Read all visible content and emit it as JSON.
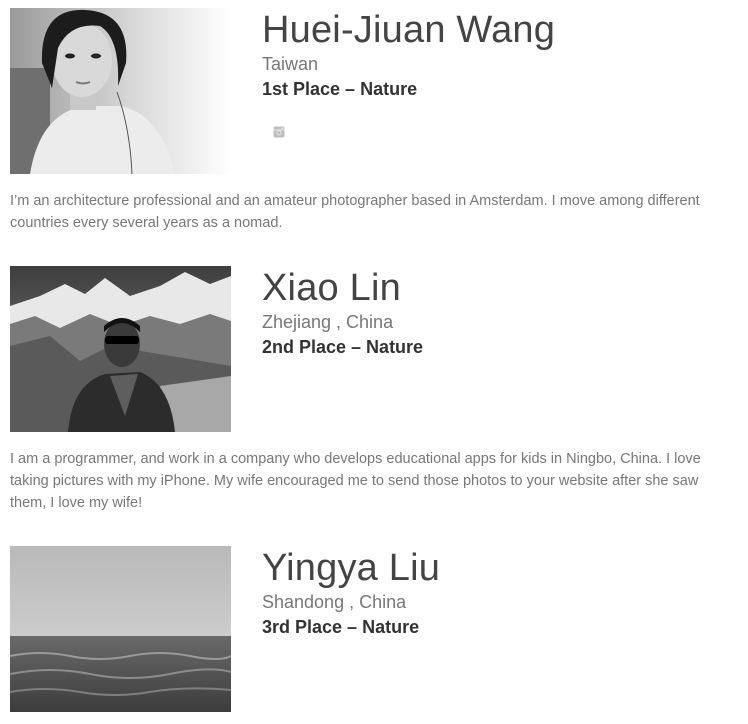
{
  "winners": [
    {
      "name": "Huei-Jiuan Wang",
      "location": "Taiwan",
      "award": "1st Place – Nature",
      "social_icon": "instagram-icon",
      "bio": "I’m an architecture professional and an amateur photographer based in Amsterdam. I move among different countries every several years as a nomad."
    },
    {
      "name": "Xiao Lin",
      "location": "Zhejiang , China",
      "award": "2nd Place – Nature",
      "bio": "I am a programmer, and work in a company who develops educational apps for kids in Ningbo, China. I love taking pictures with my iPhone. My wife encouraged me to send those photos to your website after she saw them, I love my wife!"
    },
    {
      "name": "Yingya Liu",
      "location": "Shandong , China",
      "award": "3rd Place – Nature"
    }
  ],
  "colors": {
    "name": "#444444",
    "location": "#777777",
    "award": "#333333",
    "bio": "#777777",
    "icon": "#bbbbbb"
  }
}
